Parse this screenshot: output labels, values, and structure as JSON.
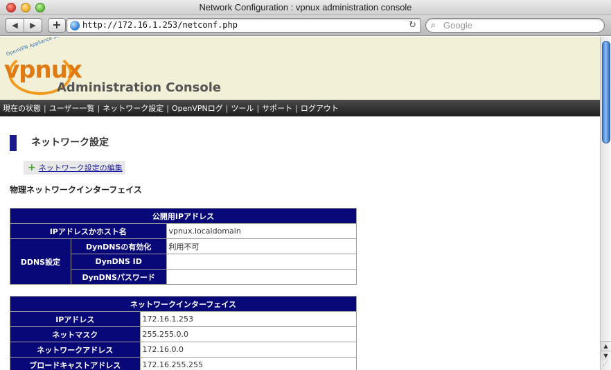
{
  "window": {
    "title": "Network Configuration : vpnux administration console"
  },
  "toolbar": {
    "back": "◀",
    "forward": "▶",
    "add": "+",
    "url": "http://172.16.1.253/netconf.php",
    "reload": "↻",
    "search_placeholder": "Google",
    "search_icon": "magnifier-icon"
  },
  "header": {
    "brand_tagline": "OpenVPN Appliance Server",
    "brand": "vpnux",
    "subtitle": "Administration Console"
  },
  "nav": {
    "items": [
      "現在の状態",
      "ユーザー一覧",
      "ネットワーク設定",
      "OpenVPNログ",
      "ツール",
      "サポート",
      "ログアウト"
    ],
    "separator": "|"
  },
  "main": {
    "title": "ネットワーク設定",
    "edit_link": "ネットワーク設定の編集",
    "section_title": "物理ネットワークインターフェイス",
    "public_ip": {
      "header": "公開用IPアドレス",
      "host_label": "IPアドレスかホスト名",
      "host_value": "vpnux.localdomain",
      "ddns_label": "DDNS設定",
      "rows": [
        {
          "label": "DynDNSの有効化",
          "value": "利用不可"
        },
        {
          "label": "DynDNS ID",
          "value": ""
        },
        {
          "label": "DynDNSパスワード",
          "value": ""
        }
      ]
    },
    "interface": {
      "header": "ネットワークインターフェイス",
      "rows": [
        {
          "label": "IPアドレス",
          "value": "172.16.1.253"
        },
        {
          "label": "ネットマスク",
          "value": "255.255.0.0"
        },
        {
          "label": "ネットワークアドレス",
          "value": "172.16.0.0"
        },
        {
          "label": "ブロードキャストアドレス",
          "value": "172.16.255.255"
        }
      ]
    }
  }
}
